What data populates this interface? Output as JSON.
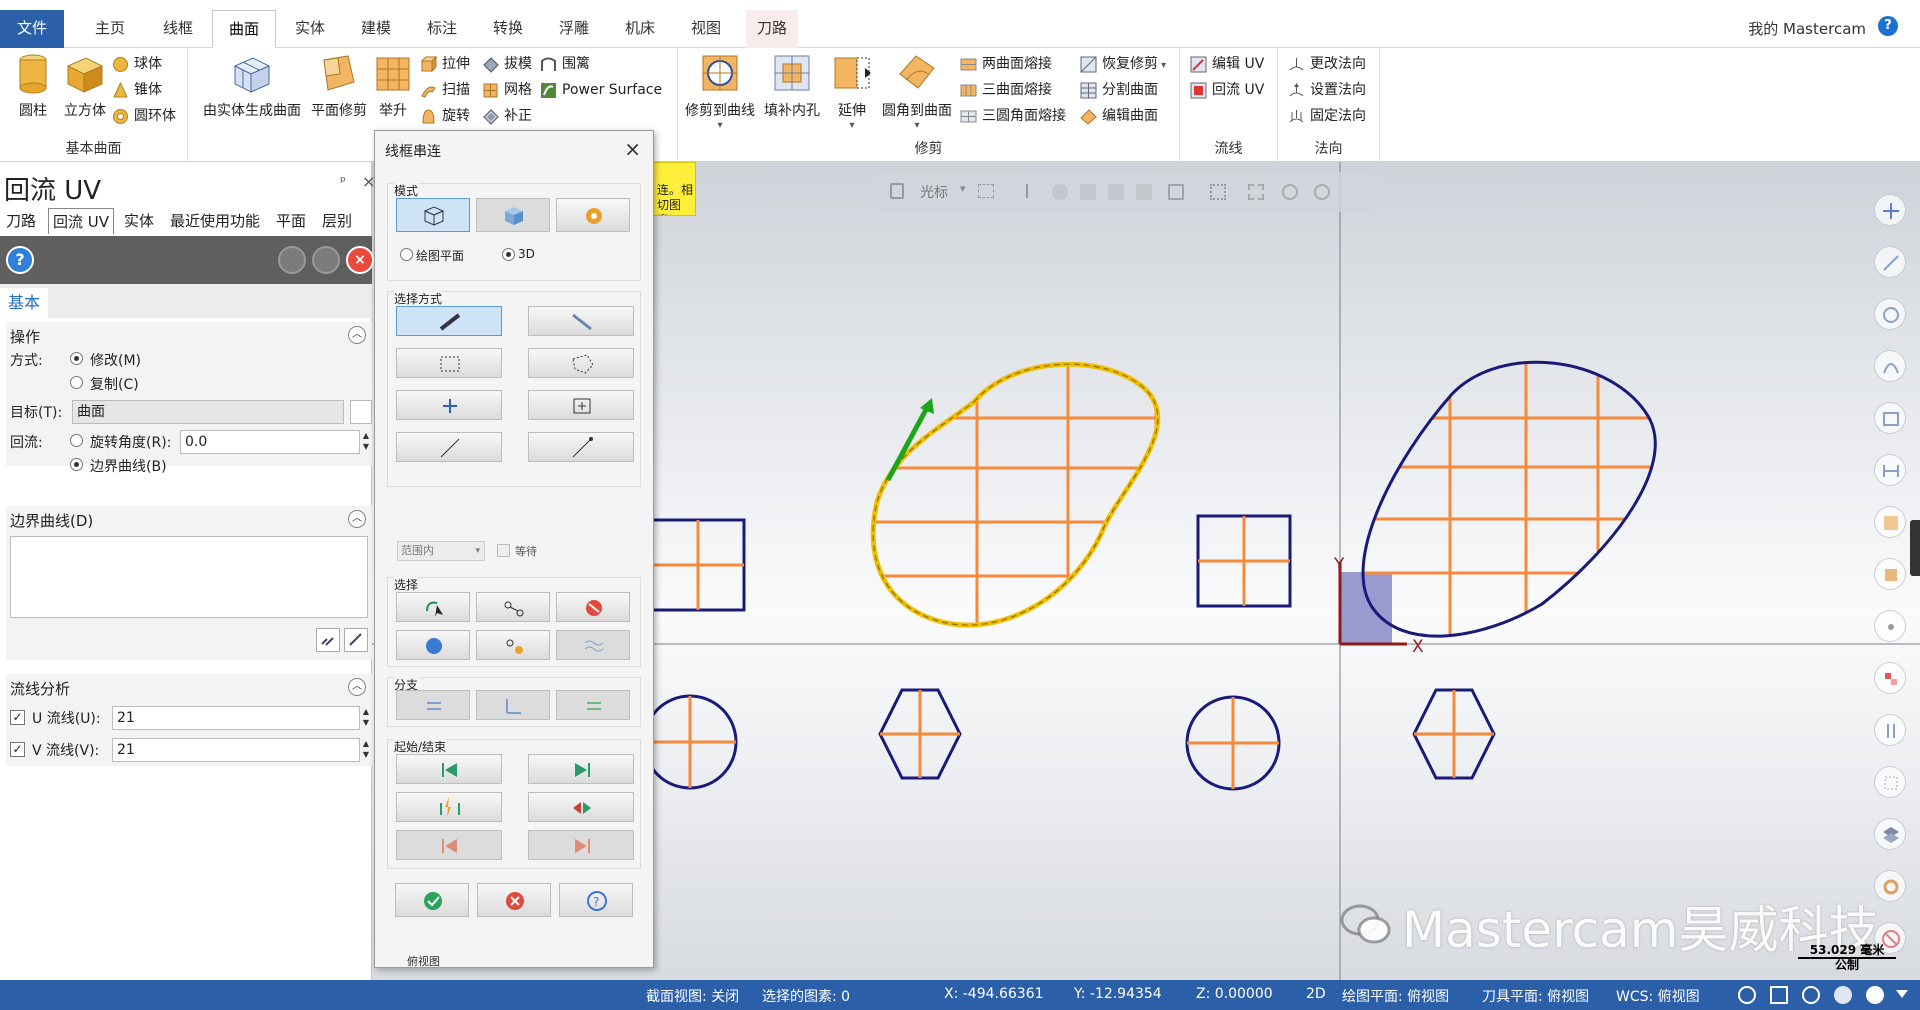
{
  "tabs": {
    "file": "文件",
    "items": [
      "主页",
      "线框",
      "曲面",
      "实体",
      "建模",
      "标注",
      "转换",
      "浮雕",
      "机床",
      "视图",
      "刀路"
    ],
    "active_index": 2,
    "user": "我的 Mastercam",
    "help": "?"
  },
  "ribbon": {
    "basic_surface": {
      "label": "基本曲面",
      "big": [
        "圆柱",
        "立方体"
      ],
      "small": [
        "球体",
        "锥体",
        "圆环体"
      ]
    },
    "create": {
      "big": [
        "由实体生成曲面",
        "平面修剪",
        "举升"
      ],
      "small": [
        "拉伸",
        "扫描",
        "旋转",
        "拔模",
        "网格",
        "补正",
        "围篱",
        "Power Surface"
      ]
    },
    "trim": {
      "label": "修剪",
      "big": [
        "修剪到曲线",
        "填补内孔",
        "延伸",
        "圆角到曲面"
      ],
      "small": [
        "两曲面熔接",
        "三曲面熔接",
        "三圆角面熔接",
        "恢复修剪",
        "分割曲面",
        "编辑曲面"
      ]
    },
    "flow": {
      "label": "流线",
      "small": [
        "编辑 UV",
        "回流 UV"
      ]
    },
    "normal": {
      "label": "法向",
      "small": [
        "更改法向",
        "设置法向",
        "固定法向"
      ]
    }
  },
  "panel": {
    "title": "回流 UV",
    "pin": "ᵖ",
    "close": "×",
    "tabs": [
      "刀路",
      "回流 UV",
      "实体",
      "最近使用功能",
      "平面",
      "层别"
    ],
    "active_tab": 1,
    "basic_tab": "基本",
    "operation": {
      "title": "操作",
      "method_label": "方式:",
      "modify": "修改(M)",
      "copy": "复制(C)",
      "target_label": "目标(T):",
      "target_value": "曲面",
      "flow_label": "回流:",
      "rotate": "旋转角度(R):",
      "rotate_value": "0.0",
      "boundary": "边界曲线(B)"
    },
    "boundary_section": {
      "title": "边界曲线(D)"
    },
    "flow_analysis": {
      "title": "流线分析",
      "u_label": "U 流线(U):",
      "u_value": "21",
      "v_label": "V 流线(V):",
      "v_value": "21"
    }
  },
  "dialog": {
    "title": "线框串连",
    "mode": {
      "title": "模式",
      "plane": "绘图平面",
      "three_d": "3D"
    },
    "select_method": {
      "title": "选择方式",
      "range": "范围内",
      "wait": "等待"
    },
    "select": {
      "title": "选择"
    },
    "branch": {
      "title": "分支"
    },
    "start_end": {
      "title": "起始/结束"
    },
    "footer_partial": "俯视图"
  },
  "viewport": {
    "toolbar_label": "光标",
    "tooltip": "连。相切图素。",
    "axis_x": "X",
    "axis_y": "Y",
    "watermark": "Mastercam昊威科技",
    "scale_value": "53.029 毫米",
    "scale_unit": "公制"
  },
  "status": {
    "section_view": "截面视图: 关闭",
    "selected": "选择的图素: 0",
    "x": "X:  -494.66361",
    "y": "Y:  -12.94354",
    "z": "Z:  0.00000",
    "mode": "2D",
    "cplane": "绘图平面: 俯视图",
    "tplane": "刀具平面: 俯视图",
    "wcs": "WCS: 俯视图"
  },
  "colors": {
    "accent": "#2b5fa7",
    "curve": "#1a1a7a",
    "grid": "#f58a3c",
    "chain": "#f0c000",
    "start_arrow": "#1aa51a"
  }
}
